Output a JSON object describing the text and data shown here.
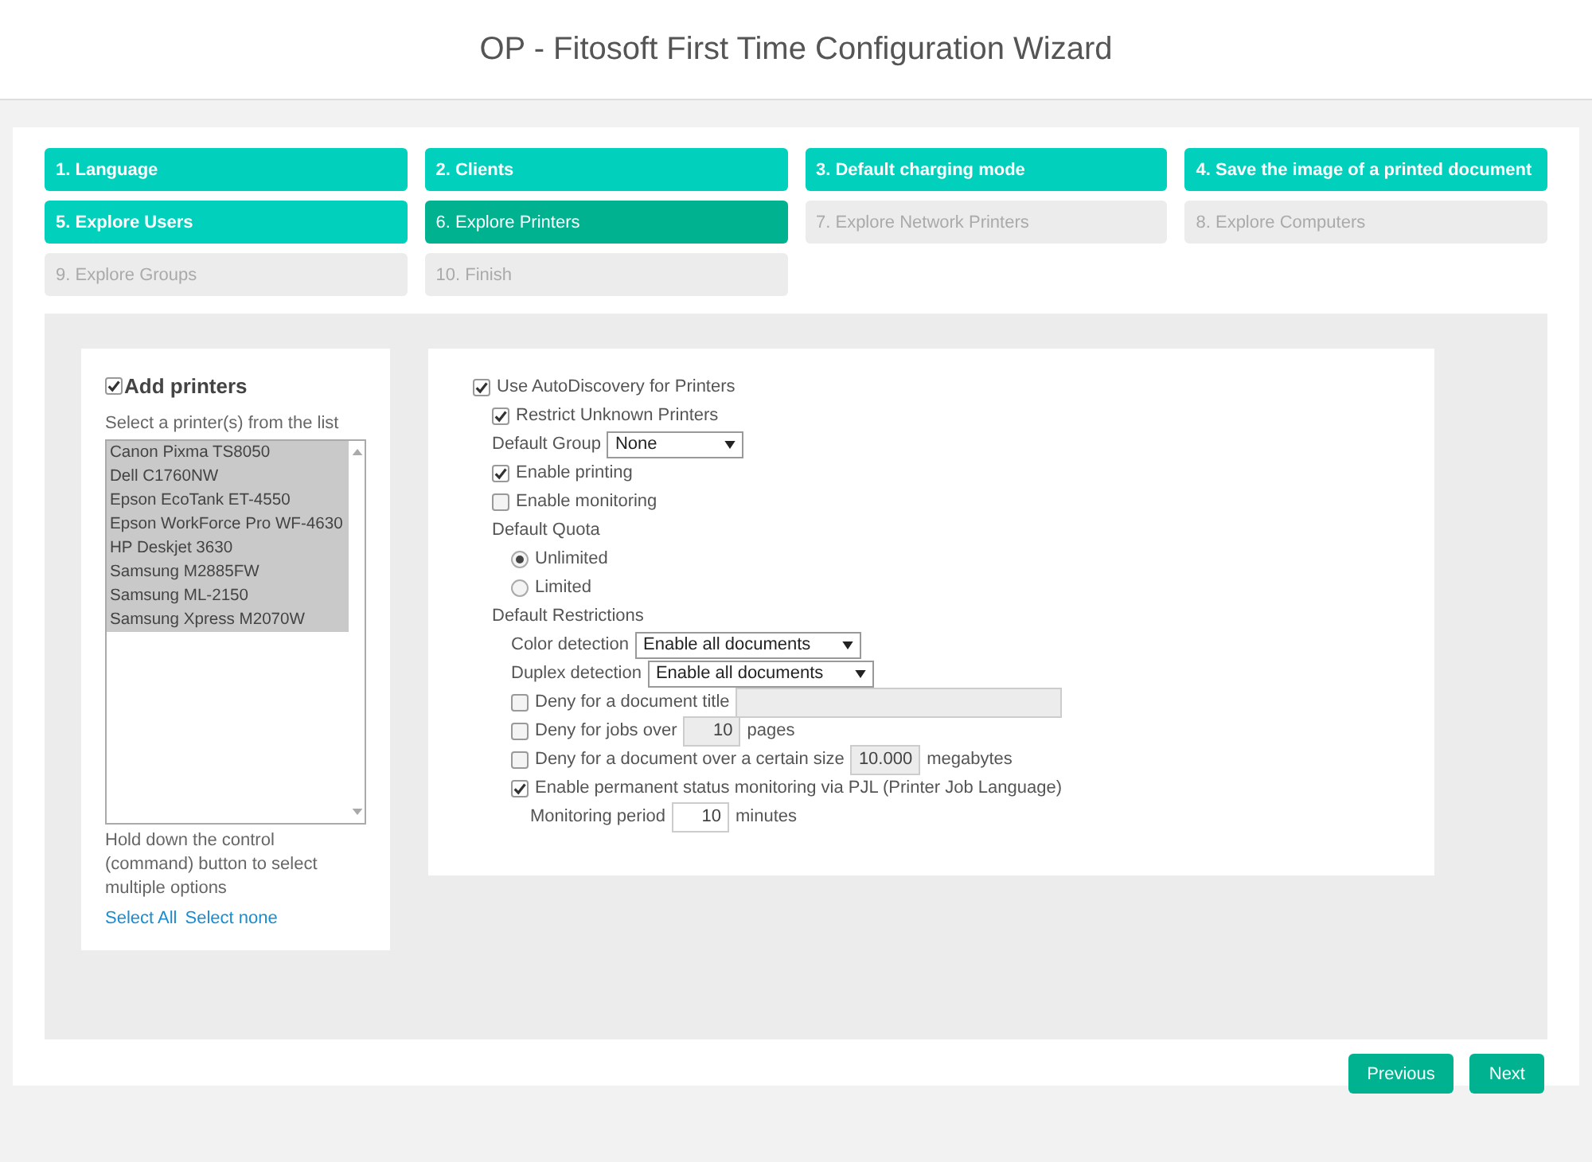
{
  "window": {
    "title": "OP - Fitosoft First Time Configuration Wizard"
  },
  "steps": [
    {
      "label": "1. Language",
      "selected": false,
      "disabled": false
    },
    {
      "label": "2. Clients",
      "selected": false,
      "disabled": false
    },
    {
      "label": "3. Default charging mode",
      "selected": false,
      "disabled": false
    },
    {
      "label": "4. Save the image of a printed document",
      "selected": false,
      "disabled": false
    },
    {
      "label": "5. Explore Users",
      "selected": false,
      "disabled": false
    },
    {
      "label": "6. Explore Printers",
      "selected": true,
      "disabled": false
    },
    {
      "label": "7. Explore Network Printers",
      "selected": false,
      "disabled": true
    },
    {
      "label": "8. Explore Computers",
      "selected": false,
      "disabled": true
    },
    {
      "label": "9. Explore Groups",
      "selected": false,
      "disabled": true
    },
    {
      "label": "10. Finish",
      "selected": false,
      "disabled": true
    }
  ],
  "add_printers": {
    "label": "Add printers",
    "checked": true,
    "list_label": "Select a printer(s) from the list",
    "printers": [
      {
        "name": "Canon Pixma TS8050",
        "selected": true
      },
      {
        "name": "Dell C1760NW",
        "selected": true
      },
      {
        "name": "Epson EcoTank ET-4550",
        "selected": true
      },
      {
        "name": "Epson WorkForce Pro WF-4630",
        "selected": true
      },
      {
        "name": "HP Deskjet 3630",
        "selected": true
      },
      {
        "name": "Samsung M2885FW",
        "selected": true
      },
      {
        "name": "Samsung ML-2150",
        "selected": true
      },
      {
        "name": "Samsung Xpress M2070W",
        "selected": true
      }
    ],
    "hint": "Hold down the control (command) button to select multiple options",
    "links": [
      "Select All",
      "Select none"
    ]
  },
  "settings": [
    {
      "kind": "checkbox",
      "label": "Use AutoDiscovery for Printers",
      "checked": true,
      "children": [
        {
          "kind": "checkbox",
          "label": "Restrict Unknown Printers",
          "checked": true
        },
        {
          "kind": "select",
          "label": "Default Group",
          "value": "None"
        },
        {
          "kind": "checkbox",
          "label": "Enable printing",
          "checked": true
        },
        {
          "kind": "checkbox",
          "label": "Enable monitoring",
          "checked": false
        },
        {
          "kind": "heading",
          "label": "Default Quota",
          "children": [
            {
              "kind": "radio",
              "label": "Unlimited",
              "selected": true
            },
            {
              "kind": "radio",
              "label": "Limited",
              "selected": false
            }
          ]
        },
        {
          "kind": "heading",
          "label": "Default Restrictions",
          "children": [
            {
              "kind": "select",
              "label": "Color detection",
              "value": "Enable all documents"
            },
            {
              "kind": "select",
              "label": "Duplex detection",
              "value": "Enable all documents"
            },
            {
              "kind": "checkbox_input",
              "label": "Deny for a document title",
              "checked": false
            },
            {
              "kind": "checkbox_input",
              "label": "Deny for jobs over",
              "checked": false,
              "value": "10",
              "unit": "pages"
            },
            {
              "kind": "checkbox_input",
              "label": "Deny for a document over a certain size",
              "checked": false,
              "value": "10.000",
              "unit": "megabytes"
            },
            {
              "kind": "checkbox",
              "label": "Enable permanent status monitoring via PJL (Printer Job Language)",
              "checked": true,
              "children": [
                {
                  "kind": "input",
                  "label": "Monitoring period",
                  "value": "10",
                  "unit": "minutes"
                }
              ]
            }
          ]
        }
      ]
    }
  ],
  "buttons": [
    "Previous",
    "Next"
  ]
}
